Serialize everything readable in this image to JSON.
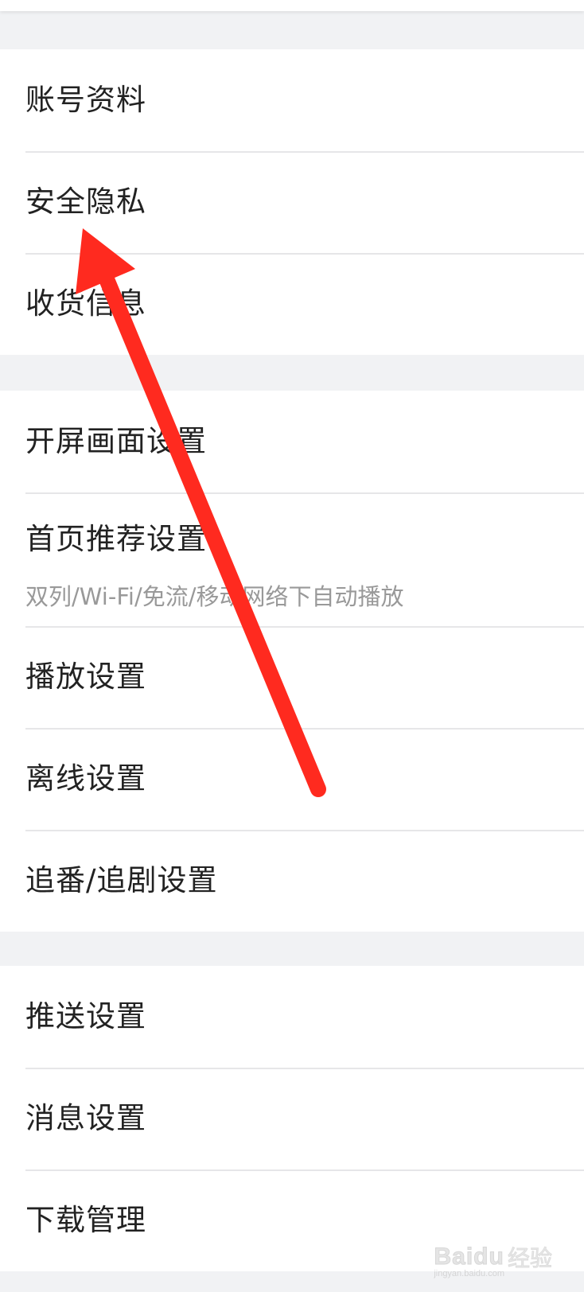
{
  "groups": [
    {
      "items": [
        {
          "label": "账号资料"
        },
        {
          "label": "安全隐私"
        },
        {
          "label": "收货信息"
        }
      ]
    },
    {
      "items": [
        {
          "label": "开屏画面设置"
        },
        {
          "label": "首页推荐设置",
          "subtitle": "双列/Wi-Fi/免流/移动网络下自动播放"
        },
        {
          "label": "播放设置"
        },
        {
          "label": "离线设置"
        },
        {
          "label": "追番/追剧设置"
        }
      ]
    },
    {
      "items": [
        {
          "label": "推送设置"
        },
        {
          "label": "消息设置"
        },
        {
          "label": "下载管理"
        }
      ]
    }
  ],
  "annotation": {
    "arrow_color": "#ff2a1f",
    "points_to": "安全隐私"
  },
  "watermark": {
    "brand": "Baidu",
    "cn": "经验",
    "site": "jingyan.baidu.com"
  }
}
